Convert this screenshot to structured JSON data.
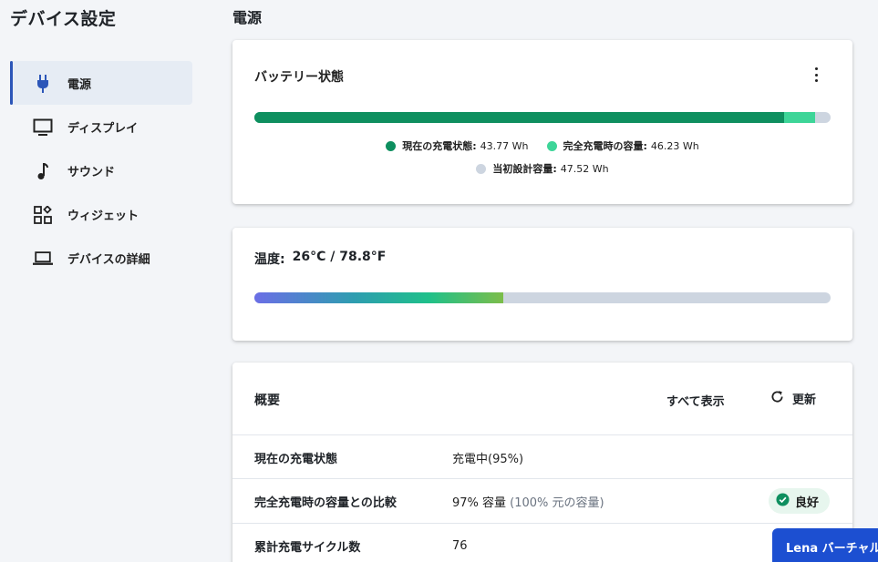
{
  "sidebar": {
    "title": "デバイス設定",
    "items": [
      {
        "label": "電源",
        "icon": "power-plug-icon",
        "active": true
      },
      {
        "label": "ディスプレイ",
        "icon": "monitor-icon",
        "active": false
      },
      {
        "label": "サウンド",
        "icon": "music-note-icon",
        "active": false
      },
      {
        "label": "ウィジェット",
        "icon": "widgets-icon",
        "active": false
      },
      {
        "label": "デバイスの詳細",
        "icon": "laptop-icon",
        "active": false
      }
    ]
  },
  "main": {
    "page_title": "電源",
    "battery": {
      "title": "バッテリー状態",
      "bar": {
        "current_fraction": 0.92,
        "full_fraction": 0.973
      },
      "legend": [
        {
          "label": "現在の充電状態:",
          "value": "43.77 Wh",
          "color": "#0e8f5f"
        },
        {
          "label": "完全充電時の容量:",
          "value": "46.23 Wh",
          "color": "#3dd598"
        },
        {
          "label": "当初設計容量:",
          "value": "47.52 Wh",
          "color": "#cdd5e0"
        }
      ]
    },
    "temperature": {
      "label": "温度:",
      "value": "26°C / 78.8°F",
      "bar": {
        "fill_fraction": 0.432
      }
    },
    "summary": {
      "title": "概要",
      "show_all": "すべて表示",
      "refresh": "更新",
      "rows": [
        {
          "label": "現在の充電状態",
          "value": "充電中(95%)",
          "value_muted": "",
          "badge": ""
        },
        {
          "label": "完全充電時の容量との比較",
          "value": "97% 容量",
          "value_muted": "(100% 元の容量)",
          "badge": "良好"
        },
        {
          "label": "累計充電サイクル数",
          "value": "76",
          "value_muted": "",
          "badge": ""
        }
      ]
    }
  },
  "assistant_button": {
    "label": "Lena バーチャル"
  },
  "colors": {
    "accent": "#2c56b8",
    "charge_current": "#0e8f5f",
    "charge_full": "#3dd598",
    "track": "#cdd5e0",
    "good_badge": "#e7f6ee",
    "assistant": "#1c4fd1"
  }
}
